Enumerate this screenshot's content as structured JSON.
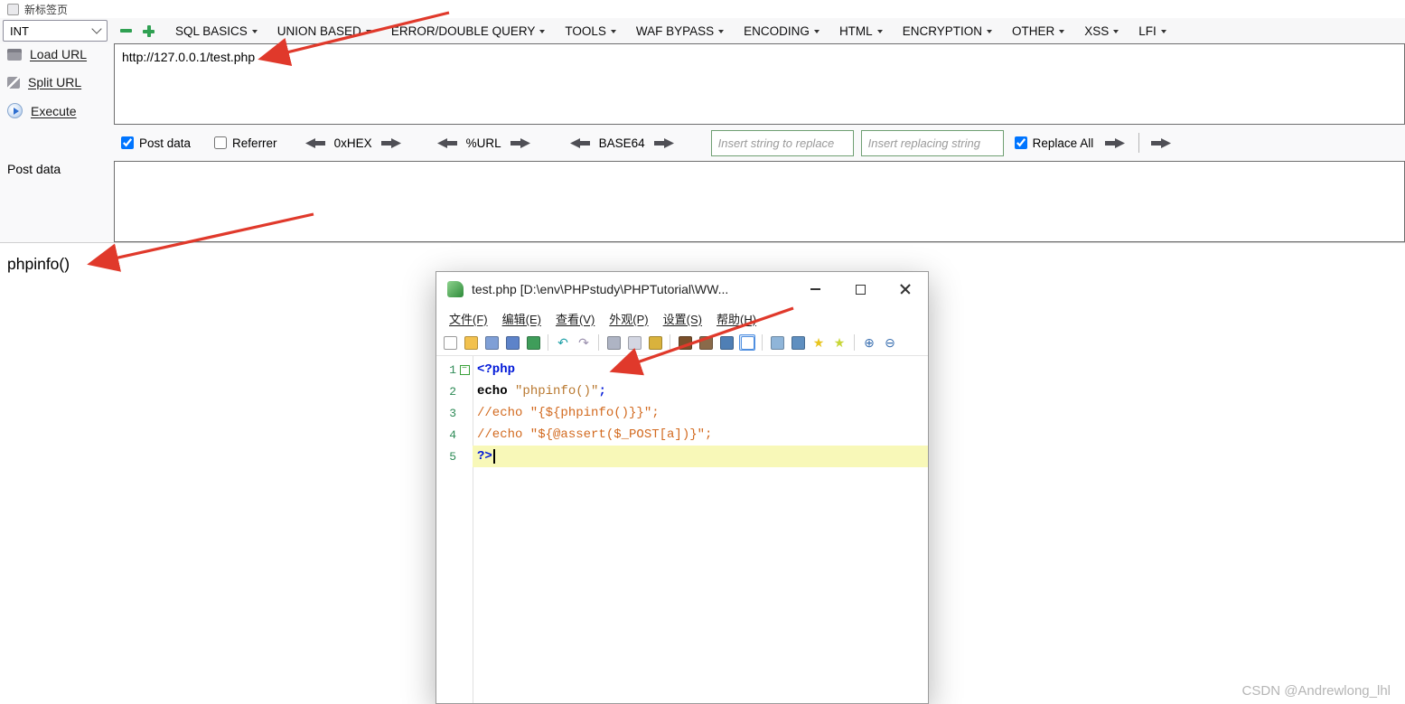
{
  "browser": {
    "tab_title": "新标签页"
  },
  "hackbar": {
    "preset_select": "INT",
    "menu": [
      "SQL BASICS",
      "UNION BASED",
      "ERROR/DOUBLE QUERY",
      "TOOLS",
      "WAF BYPASS",
      "ENCODING",
      "HTML",
      "ENCRYPTION",
      "OTHER",
      "XSS",
      "LFI"
    ],
    "sidebar": {
      "load_url": "Load URL",
      "split_url": "Split URL",
      "execute": "Execute",
      "post_data": "Post data"
    },
    "url_input": "http://127.0.0.1/test.php",
    "post_input": "",
    "controls": {
      "post_data_label": "Post data",
      "post_data_checked": true,
      "referrer_label": "Referrer",
      "referrer_checked": false,
      "hex_label": "0xHEX",
      "urlenc_label": "%URL",
      "base64_label": "BASE64",
      "replace_placeholder": "Insert string to replace",
      "replacing_placeholder": "Insert replacing string",
      "replace_all_label": "Replace All",
      "replace_all_checked": true
    }
  },
  "content": {
    "phpinfo_text": "phpinfo()"
  },
  "notepad": {
    "title": "test.php [D:\\env\\PHPstudy\\PHPTutorial\\WW...",
    "menu": [
      "文件(F)",
      "编辑(E)",
      "查看(V)",
      "外观(P)",
      "设置(S)",
      "帮助(H)"
    ],
    "toolbar": [
      {
        "name": "new-file",
        "color": "#ffffff",
        "border": "#9a9a9a"
      },
      {
        "name": "open-folder",
        "color": "#f2c14e"
      },
      {
        "name": "save",
        "color": "#7f9fd6"
      },
      {
        "name": "save-all",
        "color": "#5d83c9"
      },
      {
        "name": "reload",
        "color": "#3f9d5a"
      },
      {
        "sep": true
      },
      {
        "name": "undo",
        "glyph": "↶",
        "color": "#1fa0a8"
      },
      {
        "name": "redo",
        "glyph": "↷",
        "color": "#9a8fae"
      },
      {
        "sep": true
      },
      {
        "name": "cut",
        "color": "#aeb4c4"
      },
      {
        "name": "copy",
        "color": "#d3d6e2"
      },
      {
        "name": "paste",
        "color": "#d9b23c"
      },
      {
        "sep": true
      },
      {
        "name": "find",
        "color": "#7a4f2a"
      },
      {
        "name": "find-in-files",
        "color": "#8a6a4a"
      },
      {
        "name": "zoom",
        "color": "#4f7fb5"
      },
      {
        "name": "word-wrap",
        "color": "#ffffff",
        "border": "#4f8fe0",
        "active": true
      },
      {
        "sep": true
      },
      {
        "name": "show-symbols",
        "color": "#8fb5d9"
      },
      {
        "name": "zoom-doc",
        "color": "#5f8fc0"
      },
      {
        "name": "bookmark",
        "glyph": "★",
        "color": "#e8c51f"
      },
      {
        "name": "bookmark-next",
        "glyph": "★",
        "color": "#c8d638"
      },
      {
        "sep": true
      },
      {
        "name": "zoom-in",
        "glyph": "⊕",
        "color": "#3a6fb0"
      },
      {
        "name": "zoom-out",
        "glyph": "⊖",
        "color": "#3a6fb0"
      }
    ],
    "code": {
      "lines": [
        {
          "n": "1",
          "fold": true,
          "tokens": [
            {
              "c": "tag",
              "t": "<?php"
            }
          ]
        },
        {
          "n": "2",
          "tokens": [
            {
              "c": "kw",
              "t": "echo "
            },
            {
              "c": "str",
              "t": "\"phpinfo()\""
            },
            {
              "c": "tag",
              "t": ";"
            }
          ]
        },
        {
          "n": "3",
          "tokens": [
            {
              "c": "com",
              "t": "//echo \"{${phpinfo()}}\";"
            }
          ]
        },
        {
          "n": "4",
          "tokens": [
            {
              "c": "com",
              "t": "//echo \"${@assert($_POST[a])}\";"
            }
          ]
        },
        {
          "n": "5",
          "current": true,
          "caret": true,
          "tokens": [
            {
              "c": "tag",
              "t": "?>"
            }
          ]
        }
      ]
    }
  },
  "watermark": "CSDN @Andrewlong_lhl"
}
